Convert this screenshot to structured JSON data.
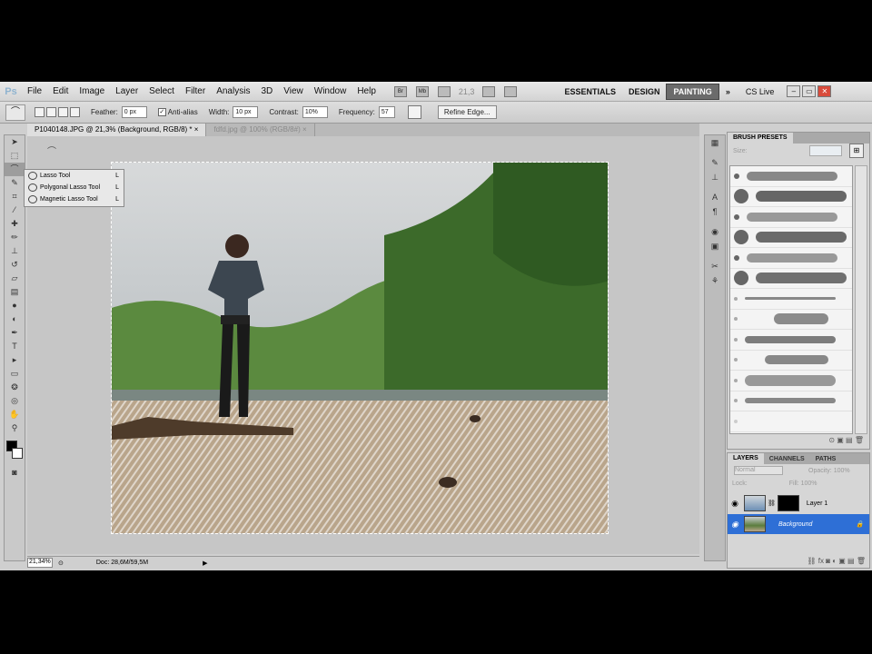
{
  "menubar": {
    "logo": "Ps",
    "items": [
      "File",
      "Edit",
      "Image",
      "Layer",
      "Select",
      "Filter",
      "Analysis",
      "3D",
      "View",
      "Window",
      "Help"
    ],
    "icon_br": "Br",
    "icon_mb": "Mb",
    "zoom": "21,3",
    "workspaces": [
      "ESSENTIALS",
      "DESIGN",
      "PAINTING"
    ],
    "active_workspace": "PAINTING",
    "more": "»",
    "cs_live": "CS Live"
  },
  "options": {
    "feather_label": "Feather:",
    "feather_value": "0 px",
    "antialias_label": "Anti-alias",
    "width_label": "Width:",
    "width_value": "10 px",
    "contrast_label": "Contrast:",
    "contrast_value": "10%",
    "frequency_label": "Frequency:",
    "frequency_value": "57",
    "refine_edge": "Refine Edge..."
  },
  "tabs": {
    "active": "P1040148.JPG @ 21,3% (Background, RGB/8) *",
    "other": "fdfd.jpg @ 100% (RGB/8#)"
  },
  "flyout": {
    "items": [
      {
        "label": "Lasso Tool",
        "shortcut": "L"
      },
      {
        "label": "Polygonal Lasso Tool",
        "shortcut": "L"
      },
      {
        "label": "Magnetic Lasso Tool",
        "shortcut": "L"
      }
    ]
  },
  "status": {
    "zoom": "21,34%",
    "doc": "Doc: 28,6M/59,5M"
  },
  "brush_panel": {
    "tabs": [
      "BRUSH PRESETS"
    ],
    "size_label": "Size:"
  },
  "layers_panel": {
    "tabs": [
      "LAYERS",
      "CHANNELS",
      "PATHS"
    ],
    "blend_mode": "Normal",
    "opacity_label": "Opacity:",
    "opacity_value": "100%",
    "lock_label": "Lock:",
    "fill_label": "Fill:",
    "fill_value": "100%",
    "layers": [
      "Layer 1",
      "Background"
    ]
  },
  "colors": {
    "selection": "#2e6fd6",
    "sky": "#c5c9cc",
    "sand": "#b9a58b",
    "trees": "#3c6a2a"
  }
}
